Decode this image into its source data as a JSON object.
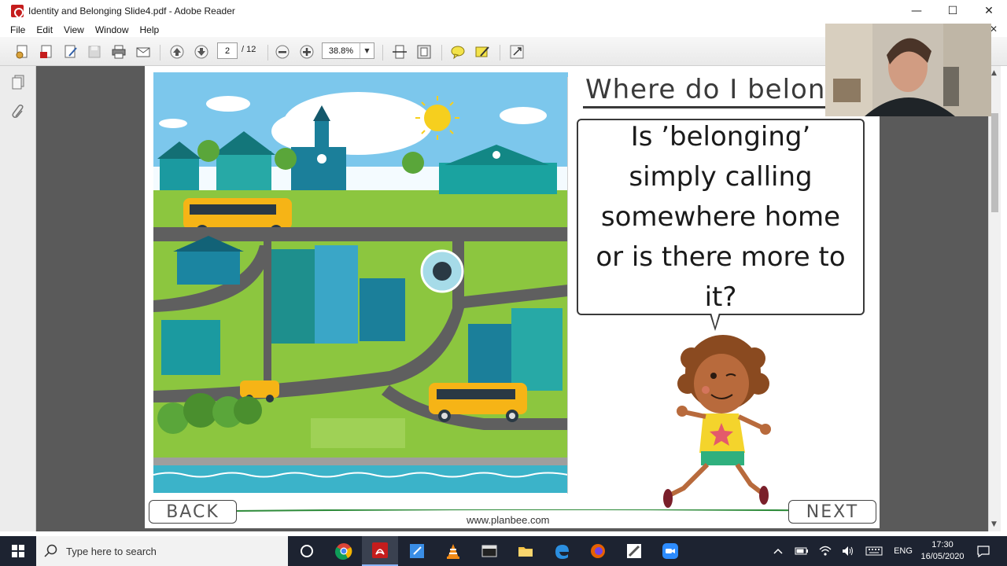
{
  "window": {
    "title": "Identity and Belonging Slide4.pdf - Adobe Reader",
    "minimize": "—",
    "maximize": "☐",
    "close": "✕"
  },
  "menu": {
    "items": [
      "File",
      "Edit",
      "View",
      "Window",
      "Help"
    ],
    "close_doc": "✕"
  },
  "toolbar": {
    "page_current": "2",
    "page_total": "/ 12",
    "zoom": "38.8%",
    "icons": [
      "create-icon",
      "pdf-icon",
      "edit-icon",
      "save-icon",
      "print-icon",
      "email-icon",
      "page-up-icon",
      "page-down-icon",
      "zoom-out-icon",
      "zoom-in-icon",
      "fit-width-icon",
      "fit-page-icon",
      "comment-icon",
      "sign-icon",
      "expand-icon"
    ]
  },
  "slide": {
    "title": "Where do I belon",
    "question": "Is ’belonging’ simply calling somewhere home or is there more to it?",
    "back": "BACK",
    "next": "NEXT",
    "website": "www.planbee.com"
  },
  "taskbar": {
    "search_placeholder": "Type here to search",
    "language": "ENG",
    "time": "17:30",
    "date": "16/05/2020",
    "apps": [
      "cortana-icon",
      "chrome-icon",
      "adobe-reader-icon",
      "notepad-icon",
      "vlc-icon",
      "media-icon",
      "file-explorer-icon",
      "edge-icon",
      "firefox-icon",
      "pencil-app-icon",
      "zoom-icon"
    ]
  },
  "colors": {
    "accent": "#c51d1d",
    "taskbar": "#1d2331",
    "doc_background": "#5a5a5a"
  }
}
